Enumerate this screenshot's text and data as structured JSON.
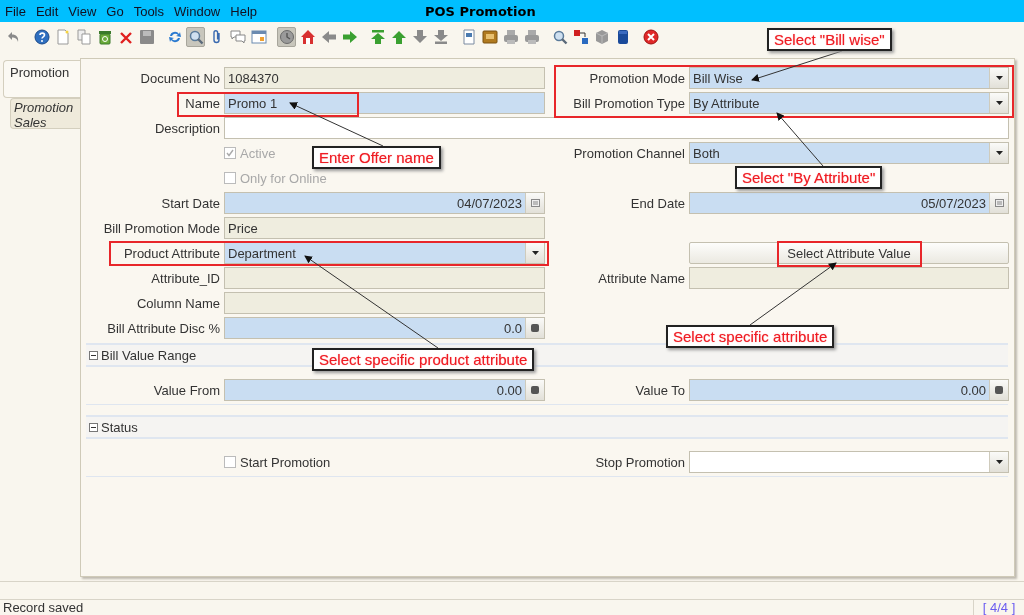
{
  "window": {
    "title": "POS Promotion"
  },
  "menu": [
    "File",
    "Edit",
    "View",
    "Go",
    "Tools",
    "Window",
    "Help"
  ],
  "toolbar": [
    [
      {
        "kind": "undo",
        "pressed": false
      }
    ],
    [
      {
        "kind": "help",
        "pressed": false
      },
      {
        "kind": "new",
        "pressed": false
      },
      {
        "kind": "copy",
        "pressed": false
      },
      {
        "kind": "bin",
        "pressed": false
      },
      {
        "kind": "cross",
        "pressed": false
      },
      {
        "kind": "floppy",
        "pressed": false
      }
    ],
    [
      {
        "kind": "refresh",
        "pressed": false
      },
      {
        "kind": "zoom",
        "pressed": true
      },
      {
        "kind": "clip",
        "pressed": false
      },
      {
        "kind": "chat",
        "pressed": false
      },
      {
        "kind": "window",
        "pressed": false
      }
    ],
    [
      {
        "kind": "clock",
        "pressed": true
      },
      {
        "kind": "home",
        "pressed": false
      },
      {
        "kind": "left",
        "pressed": false
      },
      {
        "kind": "right",
        "pressed": false
      }
    ],
    [
      {
        "kind": "top",
        "pressed": false
      },
      {
        "kind": "up",
        "pressed": false
      },
      {
        "kind": "down",
        "pressed": false
      },
      {
        "kind": "bottom",
        "pressed": false
      }
    ],
    [
      {
        "kind": "report",
        "pressed": false
      },
      {
        "kind": "box",
        "pressed": false
      },
      {
        "kind": "printer",
        "pressed": false
      },
      {
        "kind": "printer",
        "pressed": false
      }
    ],
    [
      {
        "kind": "zoom",
        "pressed": false
      },
      {
        "kind": "flow",
        "pressed": false
      },
      {
        "kind": "cube",
        "pressed": false
      },
      {
        "kind": "book",
        "pressed": false
      }
    ],
    [
      {
        "kind": "close",
        "pressed": false
      }
    ]
  ],
  "tabs": [
    {
      "label": "Promotion",
      "selected": true
    },
    {
      "label": "Promotion Sales",
      "selected": false
    }
  ],
  "form": [
    {
      "kind": "row",
      "left": {
        "kind": "text",
        "label": "Document No",
        "value": "1084370",
        "mandatory": false,
        "readonly": true
      },
      "right": {
        "kind": "combo",
        "label": "Promotion Mode",
        "value": "Bill Wise",
        "mandatory": true,
        "readonly": false
      }
    },
    {
      "kind": "row",
      "left": {
        "kind": "text",
        "label": "Name",
        "value": "Promo 1",
        "mandatory": true,
        "readonly": false
      },
      "right": {
        "kind": "combo",
        "label": "Bill Promotion Type",
        "value": "By Attribute",
        "mandatory": true,
        "readonly": false
      }
    },
    {
      "kind": "row",
      "left": {
        "kind": "text",
        "label": "Description",
        "wide": true,
        "mandatory": false,
        "readonly": false
      }
    },
    {
      "kind": "row",
      "left": {
        "kind": "checkbox",
        "label": "Active",
        "checked": true,
        "disabled": true
      },
      "right": {
        "kind": "combo",
        "label": "Promotion Channel",
        "value": "Both",
        "mandatory": true,
        "readonly": false
      }
    },
    {
      "kind": "row",
      "left": {
        "kind": "checkbox",
        "label": "Only for Online",
        "checked": false,
        "disabled": true
      }
    },
    {
      "kind": "row",
      "left": {
        "kind": "date",
        "label": "Start Date",
        "value": "04/07/2023",
        "mandatory": true,
        "readonly": false
      },
      "right": {
        "kind": "date",
        "label": "End Date",
        "value": "05/07/2023",
        "mandatory": true,
        "readonly": false
      }
    },
    {
      "kind": "row",
      "left": {
        "kind": "text",
        "label": "Bill Promotion Mode",
        "value": "Price",
        "mandatory": false,
        "readonly": true
      }
    },
    {
      "kind": "row",
      "left": {
        "kind": "combo",
        "label": "Product Attribute",
        "value": "Department",
        "mandatory": true,
        "readonly": false
      },
      "right": {
        "kind": "button",
        "label": "Select Attribute Value"
      }
    },
    {
      "kind": "row",
      "left": {
        "kind": "text",
        "label": "Attribute_ID",
        "mandatory": false,
        "readonly": true
      },
      "right": {
        "kind": "text",
        "label": "Attribute Name",
        "mandatory": false,
        "readonly": true
      }
    },
    {
      "kind": "row",
      "left": {
        "kind": "text",
        "label": "Column Name",
        "mandatory": false,
        "readonly": true
      }
    },
    {
      "kind": "row",
      "left": {
        "kind": "number",
        "label": "Bill Attribute Disc %",
        "value": "0.0",
        "mandatory": true,
        "readonly": false
      }
    },
    {
      "kind": "section",
      "label": "Bill Value Range",
      "expanded": true
    },
    {
      "kind": "row",
      "left": {
        "kind": "number",
        "label": "Value From",
        "value": "0.00",
        "mandatory": true,
        "readonly": false
      },
      "right": {
        "kind": "number",
        "label": "Value To",
        "value": "0.00",
        "mandatory": true,
        "readonly": false
      }
    },
    {
      "kind": "section",
      "label": "Status",
      "expanded": true
    },
    {
      "kind": "row",
      "left": {
        "kind": "checkbox",
        "label": "Start Promotion",
        "checked": false,
        "disabled": false
      },
      "right": {
        "kind": "combo",
        "label": "Stop Promotion",
        "mandatory": false,
        "readonly": false
      }
    }
  ],
  "annotations": [
    {
      "text": "Select \"Bill wise\""
    },
    {
      "text": "Enter Offer name"
    },
    {
      "text": "Select \"By Attribute\""
    },
    {
      "text": "Select specific attribute"
    },
    {
      "text": "Select specific product attribute"
    }
  ],
  "status_bar": {
    "message": "Record saved",
    "record": "[ 4/4 ]"
  }
}
